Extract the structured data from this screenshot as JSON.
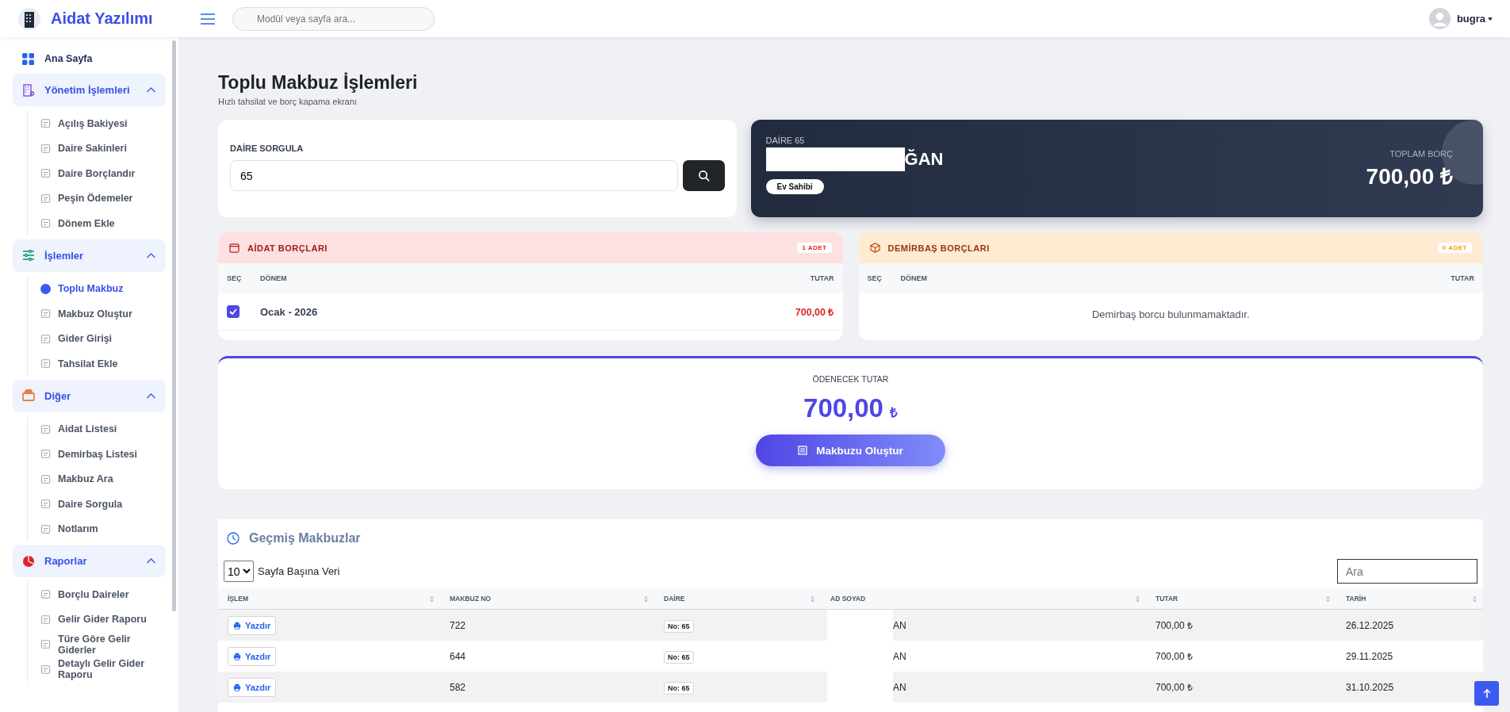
{
  "brand": {
    "name": "Aidat Yazılımı"
  },
  "search": {
    "placeholder": "Modül veya sayfa ara..."
  },
  "user": {
    "name": "bugra"
  },
  "sidebar": {
    "items": [
      {
        "label": "Ana Sayfa",
        "kind": "link"
      },
      {
        "label": "Yönetim İşlemleri",
        "kind": "group",
        "expanded": true,
        "children": [
          {
            "label": "Açılış Bakiyesi",
            "selected": false
          },
          {
            "label": "Daire Sakinleri",
            "selected": false
          },
          {
            "label": "Daire Borçlandır",
            "selected": false
          },
          {
            "label": "Peşin Ödemeler",
            "selected": false
          },
          {
            "label": "Dönem Ekle",
            "selected": false
          }
        ]
      },
      {
        "label": "İşlemler",
        "kind": "group",
        "expanded": true,
        "children": [
          {
            "label": "Toplu Makbuz",
            "selected": true
          },
          {
            "label": "Makbuz Oluştur",
            "selected": false
          },
          {
            "label": "Gider Girişi",
            "selected": false
          },
          {
            "label": "Tahsilat Ekle",
            "selected": false
          }
        ]
      },
      {
        "label": "Diğer",
        "kind": "group",
        "expanded": true,
        "children": [
          {
            "label": "Aidat Listesi",
            "selected": false
          },
          {
            "label": "Demirbaş Listesi",
            "selected": false
          },
          {
            "label": "Makbuz Ara",
            "selected": false
          },
          {
            "label": "Daire Sorgula",
            "selected": false
          },
          {
            "label": "Notlarım",
            "selected": false
          }
        ]
      },
      {
        "label": "Raporlar",
        "kind": "group",
        "expanded": true,
        "children": [
          {
            "label": "Borçlu Daireler",
            "selected": false
          },
          {
            "label": "Gelir Gider Raporu",
            "selected": false
          },
          {
            "label": "Türe Göre Gelir Giderler",
            "selected": false
          },
          {
            "label": "Detaylı Gelir Gider Raporu",
            "selected": false
          }
        ]
      }
    ]
  },
  "page": {
    "title": "Toplu Makbuz İşlemleri",
    "subtitle": "Hızlı tahsilat ve borç kapama ekranı"
  },
  "query": {
    "label": "DAİRE SORGULA",
    "value": "65"
  },
  "resident": {
    "unit": "DAİRE 65",
    "name": "ĞAN",
    "role": "Ev Sahibi",
    "total_label": "TOPLAM BORÇ",
    "total": "700,00 ₺"
  },
  "dues": {
    "title": "AİDAT BORÇLARI",
    "count": "1 ADET",
    "columns": [
      "SEÇ",
      "DÖNEM",
      "TUTAR"
    ],
    "rows": [
      {
        "period": "Ocak - 2026",
        "amount": "700,00 ₺",
        "checked": true
      }
    ]
  },
  "fixtures": {
    "title": "DEMİRBAŞ BORÇLARI",
    "count": "0 ADET",
    "columns": [
      "SEÇ",
      "DÖNEM",
      "TUTAR"
    ],
    "empty": "Demirbaş borcu bulunmamaktadır."
  },
  "payment": {
    "label": "ÖDENECEK TUTAR",
    "amount": "700,00",
    "currency": "₺",
    "button": "Makbuzu Oluştur"
  },
  "history": {
    "title": "Geçmiş Makbuzlar",
    "page_size": "10",
    "page_size_label": "Sayfa Başına Veri",
    "search_placeholder": "Ara",
    "columns": [
      "İŞLEM",
      "MAKBUZ NO",
      "DAİRE",
      "AD SOYAD",
      "TUTAR",
      "TARİH"
    ],
    "rows": [
      {
        "action": "Yazdır",
        "no": "722",
        "unit": "No: 65",
        "name": "AN",
        "amount": "700,00 ₺",
        "date": "26.12.2025"
      },
      {
        "action": "Yazdır",
        "no": "644",
        "unit": "No: 65",
        "name": "AN",
        "amount": "700,00 ₺",
        "date": "29.11.2025"
      },
      {
        "action": "Yazdır",
        "no": "582",
        "unit": "No: 65",
        "name": "AN",
        "amount": "700,00 ₺",
        "date": "31.10.2025"
      }
    ]
  }
}
